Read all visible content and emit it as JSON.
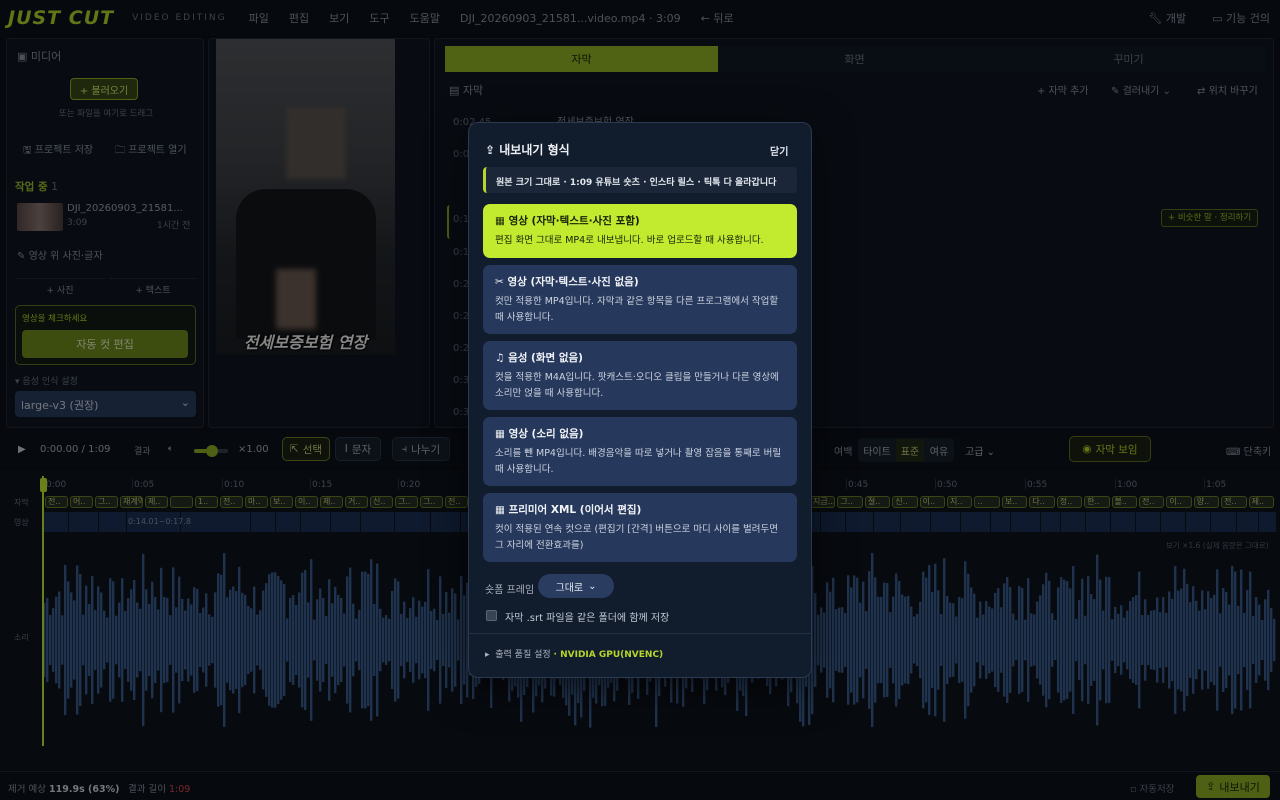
{
  "app": {
    "logo": "JUST CUT",
    "subtitle": "VIDEO EDITING",
    "menus": [
      "파일",
      "편집",
      "보기",
      "도구",
      "도움말"
    ],
    "file": "DJI_20260903_21581...video.mp4 · 3:09",
    "back": "뒤로",
    "right": [
      "개발",
      "기능 건의"
    ]
  },
  "left": {
    "media_title": "미디어",
    "import": "+ 불러오기",
    "drop_hint": "또는 파일을 여기로 드래그",
    "save_project": "프로젝트 저장",
    "open_project": "프로젝트 열기",
    "working": "작업 중",
    "working_count": "1",
    "clip_name": "DJI_20260903_21581...",
    "clip_len": "3:09",
    "clip_age": "1시간 전",
    "overlay_label": "영상 위 사진·글자",
    "add_photo": "+ 사진",
    "add_text": "+ 텍스트",
    "check_hint": "영상을 체크하세요",
    "auto_cut": "자동 컷 편집",
    "asr_label": "음성 인식 설정",
    "asr_model": "large-v3 (권장)"
  },
  "preview": {
    "caption": "전세보증보험 연장"
  },
  "right": {
    "tabs": [
      "자막",
      "화면",
      "꾸미기"
    ],
    "section": "자막",
    "add_sub": "+ 자막 추가",
    "filter": "걸러내기",
    "replace": "위치 바꾸기",
    "times": [
      "0:02.45",
      "0:0",
      "",
      "0:1",
      "0:1",
      "0:2",
      "0:2",
      "0:2",
      "0:3",
      "0:3"
    ],
    "first_line": "전세보증보험 연장",
    "merge_btn": "+ 비슷한 말 · 정리하기"
  },
  "toolbar": {
    "time": "0:00.00 / 1:09",
    "result": "결과",
    "speed": "×1.00",
    "select": "선택",
    "text": "문자",
    "split": "나누기",
    "margin": "여백",
    "tight": "타이트",
    "standard": "표준",
    "loose": "여유",
    "advanced": "고급",
    "show_sub": "자막 보임",
    "shortcut": "단축키"
  },
  "timeline": {
    "ticks": [
      "0:00",
      "0:05",
      "0:10",
      "0:15",
      "0:20",
      "0:45",
      "0:50",
      "0:55",
      "1:00",
      "1:05"
    ],
    "row_sub": "자막",
    "row_video": "영상",
    "row_audio": "소리",
    "clip_range": "0:14.01~0:17.8",
    "zoom_note": "보기 ×1.6 (실제 음량은 그대로)",
    "caps_left": [
      "전..",
      "어..",
      "그..",
      "재계약 2..",
      "제..",
      "",
      "1..",
      "전..",
      "마..",
      "보..",
      "이..",
      "제..",
      "거..",
      "신..",
      "그..",
      "그..",
      "전.."
    ],
    "caps_right": [
      "지금...",
      "그..",
      "절..",
      "신..",
      "이..",
      "지..",
      "..",
      "보..",
      "다..",
      "정..",
      "한..",
      "볼..",
      "전..",
      "이..",
      "양..",
      "전..",
      "제.."
    ]
  },
  "modal": {
    "title": "내보내기 형식",
    "close": "닫기",
    "banner": "원본 크기 그대로 · 1:09 유튜브 숏츠 · 인스타 릴스 · 틱톡 다 올라갑니다",
    "options": [
      {
        "title": "영상 (자막·텍스트·사진 포함)",
        "desc": "편집 화면 그대로 MP4로 내보냅니다. 바로 업로드할 때 사용합니다.",
        "icon": "film-icon"
      },
      {
        "title": "영상 (자막·텍스트·사진 없음)",
        "desc": "컷만 적용한 MP4입니다. 자막과 같은 항목을 다른 프로그램에서 작업할 때 사용합니다.",
        "icon": "scissors-icon"
      },
      {
        "title": "음성 (화면 없음)",
        "desc": "컷을 적용한 M4A입니다. 팟캐스트·오디오 클립을 만들거나 다른 영상에 소리만 얹을 때 사용합니다.",
        "icon": "music-icon"
      },
      {
        "title": "영상 (소리 없음)",
        "desc": "소리를 뺀 MP4입니다. 배경음악을 따로 넣거나 촬영 잡음을 통째로 버릴 때 사용합니다.",
        "icon": "film-icon"
      },
      {
        "title": "프리미어 XML (이어서 편집)",
        "desc": "컷이 적용된 연속 컷으로 (편집기 [간격] 버튼으로 마디 사이를 벌려두면 그 자리에 전환효과를)",
        "icon": "film-icon"
      }
    ],
    "frame_label": "숏폼 프레임",
    "frame_value": "그대로",
    "srt_label": "자막 .srt 파일을 같은 폴더에 함께 저장",
    "quality_label": "출력 품질 설정",
    "quality_value": "· NVIDIA GPU(NVENC)"
  },
  "status": {
    "removed_label": "제거 예상",
    "removed_value": "119.9s (63%)",
    "result_label": "결과 길이",
    "result_value": "1:09",
    "autosave": "자동저장",
    "export": "내보내기"
  },
  "colors": {
    "accent": "#c2ea2e",
    "wave": "#3b5d8f",
    "red": "#e0484d"
  }
}
